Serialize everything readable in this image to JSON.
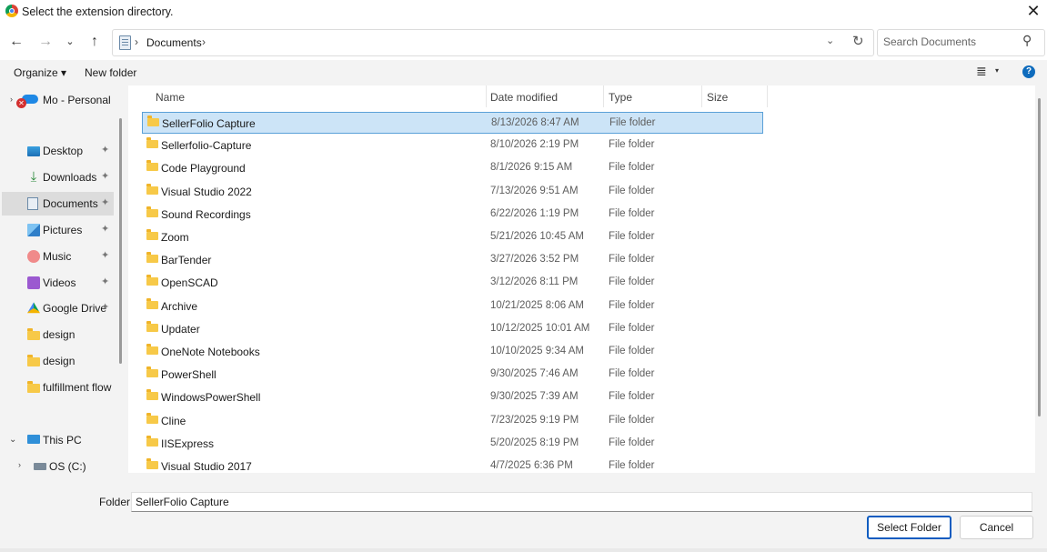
{
  "window": {
    "title": "Select the extension directory.",
    "close": "✕"
  },
  "nav": {
    "back": "←",
    "forward": "→",
    "history": "⌄",
    "up": "↑",
    "path_segment": "Documents",
    "chevron": "›",
    "dropdown": "⌄",
    "refresh": "↻"
  },
  "search": {
    "placeholder": "Search Documents",
    "icon": "⚲"
  },
  "commands": {
    "organize": "Organize ▾",
    "new_folder": "New folder",
    "view": "≣",
    "view_caret": "▾",
    "help": "?"
  },
  "sidebar": {
    "onedrive": {
      "label": "Mo - Personal",
      "error": "✕"
    },
    "quick_access": [
      {
        "label": "Desktop",
        "icon": "desktop-icon",
        "pinned": true
      },
      {
        "label": "Downloads",
        "icon": "downloads-icon",
        "pinned": true
      },
      {
        "label": "Documents",
        "icon": "documents-icon",
        "pinned": true,
        "selected": true
      },
      {
        "label": "Pictures",
        "icon": "pictures-icon",
        "pinned": true
      },
      {
        "label": "Music",
        "icon": "music-icon",
        "pinned": true
      },
      {
        "label": "Videos",
        "icon": "videos-icon",
        "pinned": true
      },
      {
        "label": "Google Drive",
        "icon": "google-drive-icon",
        "pinned": true
      },
      {
        "label": "design",
        "icon": "folder-icon",
        "pinned": false
      },
      {
        "label": "design",
        "icon": "folder-icon",
        "pinned": false
      },
      {
        "label": "fulfillment flow",
        "icon": "folder-icon",
        "pinned": false
      }
    ],
    "this_pc": "This PC",
    "os_drive": "OS (C:)",
    "pin_glyph": "📌"
  },
  "columns": {
    "name": "Name",
    "date": "Date modified",
    "type": "Type",
    "size": "Size"
  },
  "files": [
    {
      "name": "SellerFolio Capture",
      "date": "8/13/2026 8:47 AM",
      "type": "File folder",
      "selected": true
    },
    {
      "name": "Sellerfolio-Capture",
      "date": "8/10/2026 2:19 PM",
      "type": "File folder"
    },
    {
      "name": "Code Playground",
      "date": "8/1/2026 9:15 AM",
      "type": "File folder"
    },
    {
      "name": "Visual Studio 2022",
      "date": "7/13/2026 9:51 AM",
      "type": "File folder"
    },
    {
      "name": "Sound Recordings",
      "date": "6/22/2026 1:19 PM",
      "type": "File folder"
    },
    {
      "name": "Zoom",
      "date": "5/21/2026 10:45 AM",
      "type": "File folder"
    },
    {
      "name": "BarTender",
      "date": "3/27/2026 3:52 PM",
      "type": "File folder"
    },
    {
      "name": "OpenSCAD",
      "date": "3/12/2026 8:11 PM",
      "type": "File folder"
    },
    {
      "name": "Archive",
      "date": "10/21/2025 8:06 AM",
      "type": "File folder"
    },
    {
      "name": "Updater",
      "date": "10/12/2025 10:01 AM",
      "type": "File folder"
    },
    {
      "name": "OneNote Notebooks",
      "date": "10/10/2025 9:34 AM",
      "type": "File folder"
    },
    {
      "name": "PowerShell",
      "date": "9/30/2025 7:46 AM",
      "type": "File folder"
    },
    {
      "name": "WindowsPowerShell",
      "date": "9/30/2025 7:39 AM",
      "type": "File folder"
    },
    {
      "name": "Cline",
      "date": "7/23/2025 9:19 PM",
      "type": "File folder"
    },
    {
      "name": "IISExpress",
      "date": "5/20/2025 8:19 PM",
      "type": "File folder"
    },
    {
      "name": "Visual Studio 2017",
      "date": "4/7/2025 6:36 PM",
      "type": "File folder"
    }
  ],
  "footer": {
    "folder_label": "Folder:",
    "folder_value": "SellerFolio Capture",
    "select_button": "Select Folder",
    "cancel_button": "Cancel"
  },
  "colors": {
    "accent": "#0f5cc0",
    "selection": "#cce4f7",
    "folder": "#f7c948"
  }
}
